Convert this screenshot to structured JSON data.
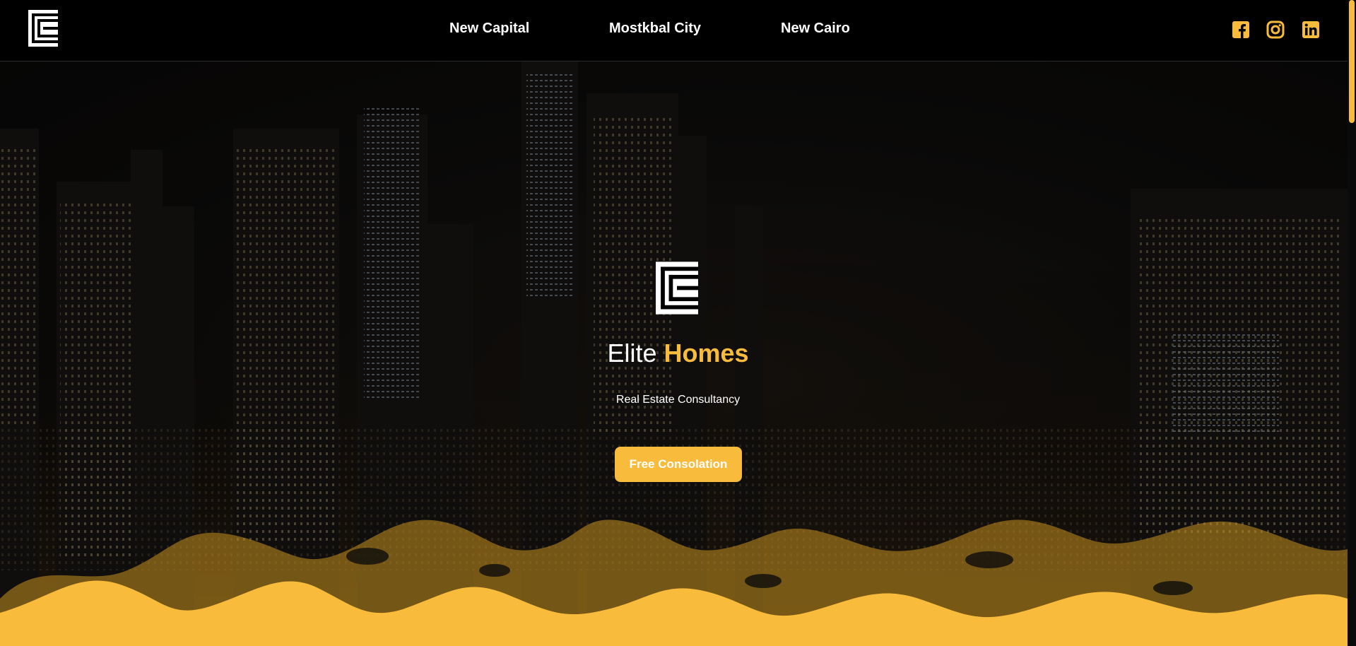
{
  "colors": {
    "accent": "#f8bb3c",
    "header_bg": "#000000",
    "text": "#ffffff"
  },
  "header": {
    "logo": "elite-homes-logo",
    "nav": [
      {
        "label": "New Capital"
      },
      {
        "label": "Mostkbal City"
      },
      {
        "label": "New Cairo"
      }
    ],
    "social": [
      {
        "icon": "facebook-icon"
      },
      {
        "icon": "instagram-icon"
      },
      {
        "icon": "linkedin-icon"
      }
    ]
  },
  "hero": {
    "title_part1": "Elite",
    "title_part2": "Homes",
    "subtitle": "Real Estate Consultancy",
    "cta_label": "Free Consolation"
  }
}
